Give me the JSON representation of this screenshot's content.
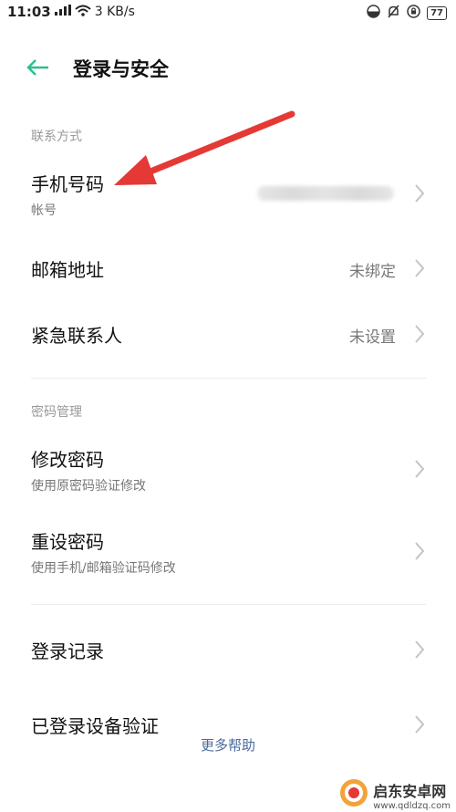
{
  "status_bar": {
    "time": "11:03",
    "network_speed": "3 KB/s",
    "battery_level": "77"
  },
  "header": {
    "title": "登录与安全"
  },
  "sections": {
    "contact_label": "联系方式",
    "password_label": "密码管理"
  },
  "rows": {
    "phone": {
      "title": "手机号码",
      "subtitle": "帐号"
    },
    "email": {
      "title": "邮箱地址",
      "value": "未绑定"
    },
    "emergency": {
      "title": "紧急联系人",
      "value": "未设置"
    },
    "change_password": {
      "title": "修改密码",
      "subtitle": "使用原密码验证修改"
    },
    "reset_password": {
      "title": "重设密码",
      "subtitle": "使用手机/邮箱验证码修改"
    },
    "login_records": {
      "title": "登录记录"
    },
    "device_verification": {
      "title": "已登录设备验证"
    }
  },
  "footer": {
    "more_help": "更多帮助"
  },
  "watermark": {
    "line1": "启东安卓网",
    "line2": "www.qdldzq.com"
  },
  "colors": {
    "accent": "#2bbf8a",
    "annotation_arrow": "#e53935",
    "link": "#4a6a9a"
  }
}
